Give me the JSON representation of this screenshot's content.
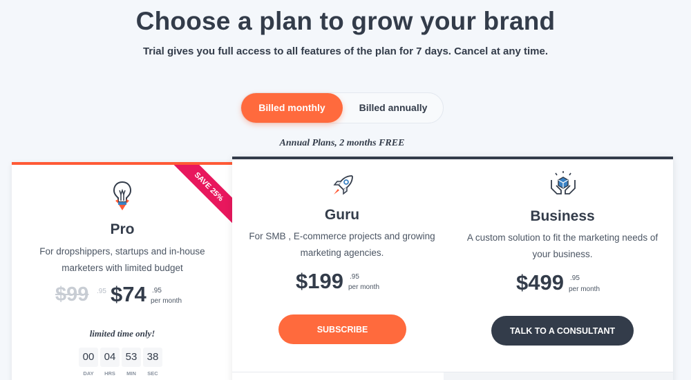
{
  "header": {
    "title": "Choose a plan to grow your brand",
    "subtitle": "Trial gives you full access to all features of the plan for 7 days. Cancel at any time."
  },
  "billing_toggle": {
    "monthly_label": "Billed monthly",
    "annual_label": "Billed annually",
    "selected": "Billed monthly"
  },
  "annual_note": "Annual Plans, 2 months FREE",
  "plans": {
    "pro": {
      "ribbon": "SAVE 25%",
      "icon": "lightbulb-rocket-icon",
      "name": "Pro",
      "description_line1": "For dropshippers, startups and in-house",
      "description_line2": "marketers with limited budget",
      "old_price": "$99",
      "old_cents": ".95",
      "price": "$74",
      "cents": ".95",
      "per": "per month",
      "limited": "limited time only!",
      "countdown": [
        {
          "value": "00",
          "label": "DAY"
        },
        {
          "value": "04",
          "label": "HRS"
        },
        {
          "value": "53",
          "label": "MIN"
        },
        {
          "value": "38",
          "label": "SEC"
        }
      ]
    },
    "guru": {
      "icon": "rocket-icon",
      "name": "Guru",
      "description_line1": "For SMB , E-commerce projects and growing",
      "description_line2": "marketing agencies.",
      "price": "$199",
      "cents": ".95",
      "per": "per month",
      "button": "SUBSCRIBE"
    },
    "business": {
      "icon": "hands-cube-icon",
      "name": "Business",
      "description_line1": "A custom solution to fit the marketing needs of",
      "description_line2": "your business.",
      "price": "$499",
      "cents": ".95",
      "per": "per month",
      "button": "TALK TO A CONSULTANT"
    }
  },
  "colors": {
    "accent": "#ff6a3d",
    "ribbon": "#e8175d",
    "dark": "#333c4a",
    "background": "#f4f7fb"
  }
}
